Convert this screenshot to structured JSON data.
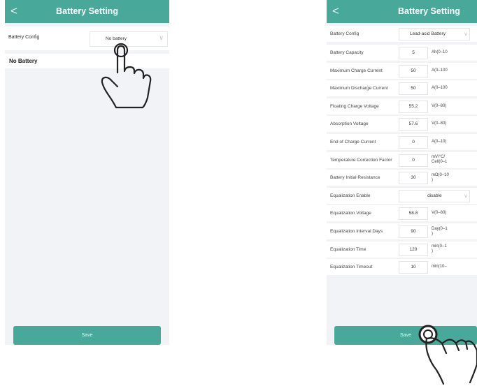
{
  "left_screen": {
    "title": "Battery Setting",
    "back": "<",
    "config_label": "Battery Config",
    "config_value": "No battery",
    "status": "No Battery",
    "save": "Save"
  },
  "right_screen": {
    "title": "Battery Setting",
    "back": "<",
    "config_label": "Battery Config",
    "config_value": "Lead-acid Battery",
    "rows": [
      {
        "label": "Battery Capacity",
        "value": "5",
        "unit": "Ah(0–10"
      },
      {
        "label": "Maximum Charge Current",
        "value": "50",
        "unit": "A(0–100"
      },
      {
        "label": "Maximum Discharge Current",
        "value": "50",
        "unit": "A(0–100"
      },
      {
        "label": "Floating Charge Voltage",
        "value": "55.2",
        "unit": "V(0–80)"
      },
      {
        "label": "Absorption Voltage",
        "value": "57.6",
        "unit": "V(0–80)"
      },
      {
        "label": "End of Charge Current",
        "value": "0",
        "unit": "A(0–10)"
      },
      {
        "label": "Temperature Correction Factor",
        "value": "0",
        "unit": "mV/°C/\nCell(0–1"
      },
      {
        "label": "Battery Initial Resistance",
        "value": "30",
        "unit": "mΩ(0–10\n)"
      },
      {
        "label": "Equalization Enable",
        "value": "disable",
        "unit": ""
      },
      {
        "label": "Equalization Voltage",
        "value": "58.8",
        "unit": "V(0–80)"
      },
      {
        "label": "Equalization Interval Days",
        "value": "90",
        "unit": "Day(0–1\n)"
      },
      {
        "label": "Equalization Time",
        "value": "120",
        "unit": "min(0–1\n)"
      },
      {
        "label": "Equalization Timeout",
        "value": "10",
        "unit": "min(10–"
      }
    ],
    "save": "Save"
  },
  "icons": {
    "chevron": "chevron-down-icon",
    "pointer": "hand-pointer-icon"
  }
}
